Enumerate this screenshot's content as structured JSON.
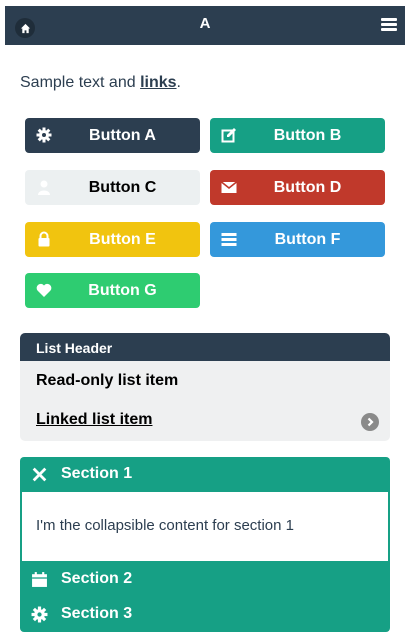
{
  "header": {
    "title": "A"
  },
  "sample": {
    "text": "Sample text and ",
    "link": "links",
    "end": "."
  },
  "buttons": [
    {
      "label": "Button A",
      "color": "#2c3e50",
      "icon": "gear-icon"
    },
    {
      "label": "Button B",
      "color": "#16a085",
      "icon": "edit-icon"
    },
    {
      "label": "Button C",
      "color": "#ecf0f1",
      "icon": "user-icon"
    },
    {
      "label": "Button D",
      "color": "#c0392b",
      "icon": "mail-icon"
    },
    {
      "label": "Button E",
      "color": "#f1c40f",
      "icon": "lock-icon"
    },
    {
      "label": "Button F",
      "color": "#3498db",
      "icon": "bars-icon"
    },
    {
      "label": "Button G",
      "color": "#2ecc71",
      "icon": "heart-icon"
    }
  ],
  "list": {
    "header": "List Header",
    "readonly_item": "Read-only list item",
    "linked_item": "Linked list item"
  },
  "collapsible": {
    "sections": [
      {
        "label": "Section 1",
        "icon": "close-icon",
        "expanded": true,
        "content": "I'm the collapsible content for section 1"
      },
      {
        "label": "Section 2",
        "icon": "calendar-icon",
        "expanded": false
      },
      {
        "label": "Section 3",
        "icon": "gear-icon",
        "expanded": false
      }
    ]
  }
}
